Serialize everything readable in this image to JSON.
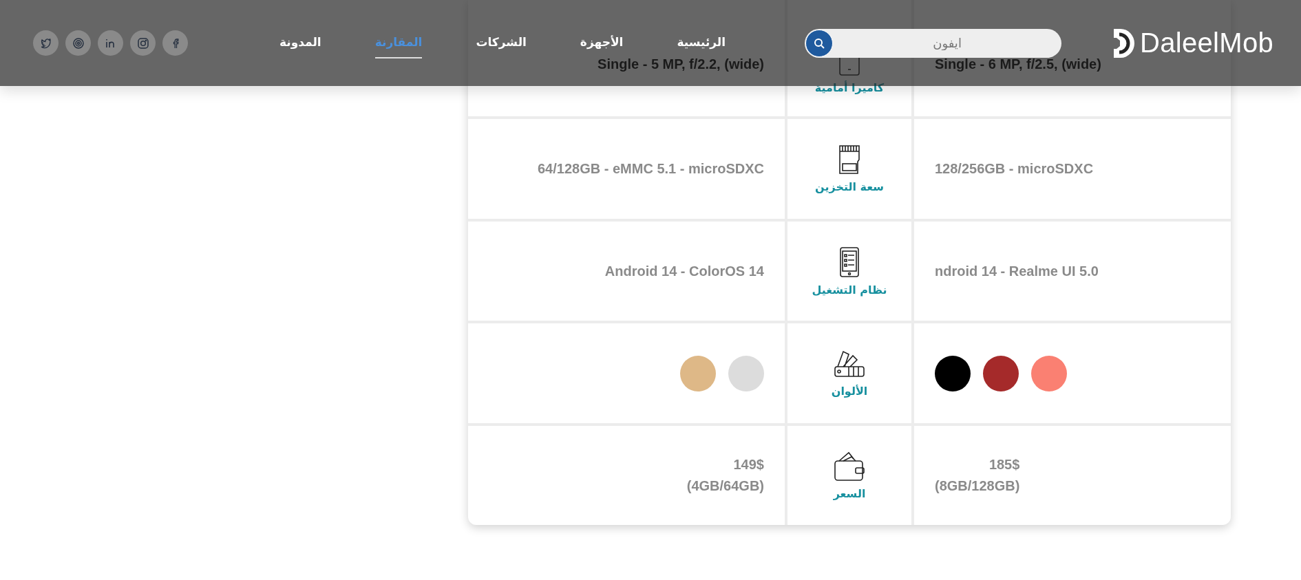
{
  "header": {
    "logo": "DaleelMob",
    "search": {
      "placeholder": "ايفون"
    },
    "nav": [
      {
        "label": "الرئيسية",
        "selected": false
      },
      {
        "label": "الأجهزة",
        "selected": false
      },
      {
        "label": "الشركات",
        "selected": false
      },
      {
        "label": "المقارنة",
        "selected": true
      },
      {
        "label": "المدونة",
        "selected": false
      }
    ]
  },
  "comparison": {
    "rows": [
      {
        "kind": "text",
        "label": "كاميرا أمامية",
        "phone_1": "Single - 6 MP, f/2.5, (wide)",
        "phone_2": "Single - 5 MP, f/2.2, (wide)"
      },
      {
        "kind": "text",
        "label": "سعة التخزين",
        "phone_1": "128/256GB - microSDXC",
        "phone_2": "64/128GB - eMMC 5.1 - microSDXC"
      },
      {
        "kind": "text",
        "label": "نظام التشغيل",
        "phone_1": "ndroid 14 - Realme UI 5.0",
        "phone_2": "Android 14 - ColorOS 14"
      },
      {
        "kind": "colors",
        "label": "الألوان",
        "phone_1": [
          {
            "color": "#fa8072"
          },
          {
            "color": "#a52a2a"
          },
          {
            "color": "#000000"
          }
        ],
        "phone_2": [
          {
            "color": "#dcdcdc"
          },
          {
            "color": "#deb887"
          }
        ]
      },
      {
        "kind": "price",
        "label": "السعر",
        "phone_1": {
          "price": "185$",
          "variant": "(8GB/128GB)"
        },
        "phone_2": {
          "price": "149$",
          "variant": "(4GB/64GB)"
        }
      }
    ]
  }
}
